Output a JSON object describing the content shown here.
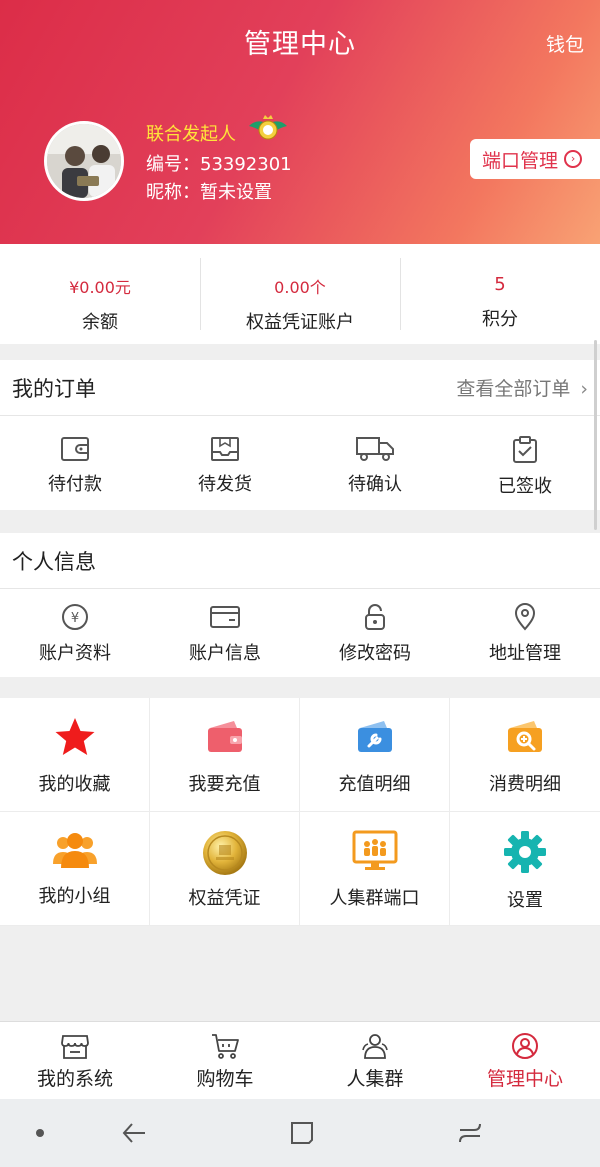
{
  "header": {
    "title": "管理中心",
    "wallet_label": "钱包",
    "role": "联合发起人",
    "user_id": "编号：53392301",
    "nickname": "昵称：暂未设置",
    "port_button": "端口管理"
  },
  "stats": [
    {
      "value": "¥0.00元",
      "label": "余额"
    },
    {
      "value": "0.00个",
      "label": "权益凭证账户"
    },
    {
      "value": "5",
      "label": "积分"
    }
  ],
  "orders": {
    "title": "我的订单",
    "more": "查看全部订单",
    "items": [
      {
        "label": "待付款",
        "icon": "wallet-icon"
      },
      {
        "label": "待发货",
        "icon": "package-icon"
      },
      {
        "label": "待确认",
        "icon": "truck-icon"
      },
      {
        "label": "已签收",
        "icon": "clipboard-check-icon"
      }
    ]
  },
  "personal": {
    "title": "个人信息",
    "items": [
      {
        "label": "账户资料",
        "icon": "yen-coin-icon"
      },
      {
        "label": "账户信息",
        "icon": "card-icon"
      },
      {
        "label": "修改密码",
        "icon": "lock-icon"
      },
      {
        "label": "地址管理",
        "icon": "location-pin-icon"
      }
    ]
  },
  "grid": [
    {
      "label": "我的收藏",
      "icon": "star-icon"
    },
    {
      "label": "我要充值",
      "icon": "recharge-wallet-icon"
    },
    {
      "label": "充值明细",
      "icon": "wrench-wallet-icon"
    },
    {
      "label": "消费明细",
      "icon": "magnifier-wallet-icon"
    },
    {
      "label": "我的小组",
      "icon": "group-icon"
    },
    {
      "label": "权益凭证",
      "icon": "gold-coin-icon"
    },
    {
      "label": "人集群端口",
      "icon": "monitor-group-icon"
    },
    {
      "label": "设置",
      "icon": "gear-icon"
    }
  ],
  "tabs": [
    {
      "label": "我的系统",
      "icon": "store-icon"
    },
    {
      "label": "购物车",
      "icon": "cart-icon"
    },
    {
      "label": "人集群",
      "icon": "people-icon"
    },
    {
      "label": "管理中心",
      "icon": "user-circle-icon",
      "active": true
    }
  ],
  "colors": {
    "accent": "#d42a3e",
    "header_start": "#dc2d48",
    "header_end": "#f8a274",
    "role_yellow": "#ffe43a"
  }
}
